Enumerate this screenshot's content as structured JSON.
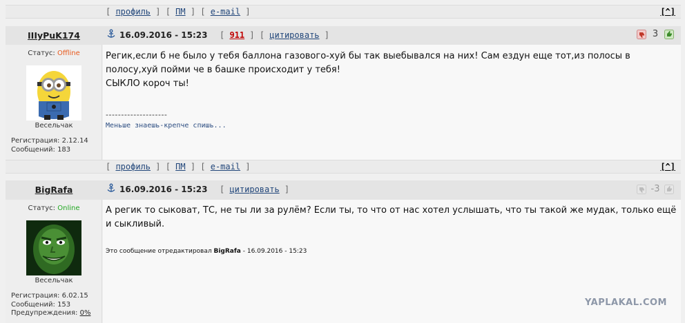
{
  "top_bar": {
    "profile": "профиль",
    "pm": "ПМ",
    "email": "e-mail",
    "up": "[^]"
  },
  "posts": [
    {
      "username": "IIIyPuK174",
      "date": "16.09.2016 - 15:23",
      "post_number": "911",
      "quote_label": "цитировать",
      "rating": "3",
      "status_label": "Статус:",
      "status": "Offline",
      "rank": "Весельчак",
      "reg_label": "Регистрация:",
      "reg_date": "2.12.14",
      "msg_label": "Сообщений:",
      "msg_count": "183",
      "text": "Регик,если б не было у тебя баллона газового-хуй бы так выебывался на них! Сам ездун еще тот,из полосы в полосу,хуй пойми че в башке происходит у тебя!\nСЫКЛО короч ты!",
      "divider": "--------------------",
      "signature": "Меньше знаешь-крепче спишь...",
      "links": {
        "profile": "профиль",
        "pm": "ПМ",
        "email": "e-mail",
        "up": "[^]"
      }
    },
    {
      "username": "BigRafa",
      "date": "16.09.2016 - 15:23",
      "quote_label": "цитировать",
      "rating": "-3",
      "status_label": "Статус:",
      "status": "Online",
      "rank": "Весельчак",
      "reg_label": "Регистрация:",
      "reg_date": "6.02.15",
      "msg_label": "Сообщений:",
      "msg_count": "153",
      "warn_label": "Предупреждения:",
      "warn_value": "0%",
      "text": "А регик то сыковат, ТС, не ты ли за рулём? Если ты, то что от нас хотел услышать, что ты такой же мудак, только ещё и сыкливый.",
      "edit_prefix": "Это сообщение отредактировал",
      "edit_user": "BigRafa",
      "edit_date": "- 16.09.2016 - 15:23"
    }
  ],
  "watermark": "YAPLAKAL.COM",
  "colors": {
    "offline": "#e85a1e",
    "online": "#22a822",
    "post_number": "#c00000",
    "link": "#21467a"
  }
}
